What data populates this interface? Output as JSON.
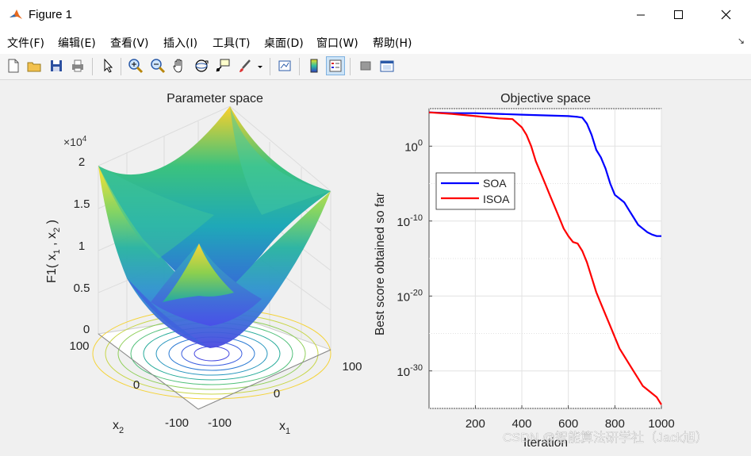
{
  "window": {
    "title": "Figure 1",
    "controls": [
      "minimize",
      "maximize",
      "close"
    ]
  },
  "menu": {
    "items": [
      "文件(F)",
      "编辑(E)",
      "查看(V)",
      "插入(I)",
      "工具(T)",
      "桌面(D)",
      "窗口(W)",
      "帮助(H)"
    ]
  },
  "toolbar": {
    "icons": [
      "new-figure-icon",
      "open-file-icon",
      "save-icon",
      "print-icon",
      "select-arrow-icon",
      "zoom-in-icon",
      "zoom-out-icon",
      "pan-hand-icon",
      "rotate-3d-icon",
      "data-cursor-icon",
      "brush-icon",
      "brush-dropdown-icon",
      "link-plot-icon",
      "colorbar-icon",
      "legend-icon",
      "hide-plot-tools-icon",
      "show-plot-tools-icon"
    ]
  },
  "left_axes": {
    "title": "Parameter space",
    "exponent_label": "×10",
    "exponent_power": "4",
    "zlabel": "F1( x",
    "z_ticks": [
      "2",
      "1.5",
      "1",
      "0.5",
      "0"
    ],
    "x1_ticks": [
      "-100",
      "0",
      "100"
    ],
    "x2_ticks": [
      "100",
      "0",
      "-100"
    ],
    "x1_label": "x",
    "x1_sub": "1",
    "x2_label": "x",
    "x2_sub": "2"
  },
  "chart_data": {
    "type": "line",
    "title": "Objective space",
    "xlabel": "Iteration",
    "ylabel": "Best score obtained so far",
    "x_ticks": [
      "200",
      "400",
      "600",
      "800",
      "1000"
    ],
    "y_ticks": [
      "10^0",
      "10^-10",
      "10^-20",
      "10^-30"
    ],
    "xlim": [
      1,
      1000
    ],
    "ylim_log10": [
      -35,
      5
    ],
    "yscale": "log",
    "grid": true,
    "legend_position": "left-middle",
    "series": [
      {
        "name": "SOA",
        "color": "#0000ff",
        "x": [
          1,
          100,
          200,
          300,
          400,
          500,
          600,
          640,
          660,
          680,
          700,
          720,
          740,
          760,
          780,
          800,
          820,
          840,
          860,
          880,
          900,
          920,
          940,
          960,
          980,
          1000
        ],
        "log10_y": [
          4.5,
          4.4,
          4.4,
          4.3,
          4.2,
          4.1,
          4.0,
          3.9,
          3.8,
          3.0,
          1.5,
          -0.5,
          -1.5,
          -3.0,
          -5.0,
          -6.5,
          -7.0,
          -7.5,
          -8.5,
          -9.5,
          -10.5,
          -11.0,
          -11.5,
          -11.8,
          -12.0,
          -12.0
        ]
      },
      {
        "name": "ISOA",
        "color": "#ff0000",
        "x": [
          1,
          100,
          200,
          300,
          360,
          400,
          420,
          440,
          460,
          480,
          500,
          520,
          540,
          560,
          580,
          600,
          620,
          640,
          660,
          680,
          700,
          720,
          740,
          760,
          780,
          800,
          820,
          840,
          860,
          880,
          900,
          920,
          940,
          960,
          980,
          1000
        ],
        "log10_y": [
          4.5,
          4.3,
          4.0,
          3.7,
          3.6,
          2.5,
          1.5,
          0.0,
          -2.0,
          -3.5,
          -5.0,
          -6.5,
          -8.0,
          -9.5,
          -11.0,
          -12.0,
          -12.8,
          -13.0,
          -14.0,
          -15.5,
          -17.5,
          -19.5,
          -21.0,
          -22.5,
          -24.0,
          -25.5,
          -27.0,
          -28.0,
          -29.0,
          -30.0,
          -31.0,
          -32.0,
          -32.5,
          -33.0,
          -33.5,
          -34.5
        ]
      }
    ]
  },
  "watermark": "CSDN @智能算法研学社（Jack旭）"
}
